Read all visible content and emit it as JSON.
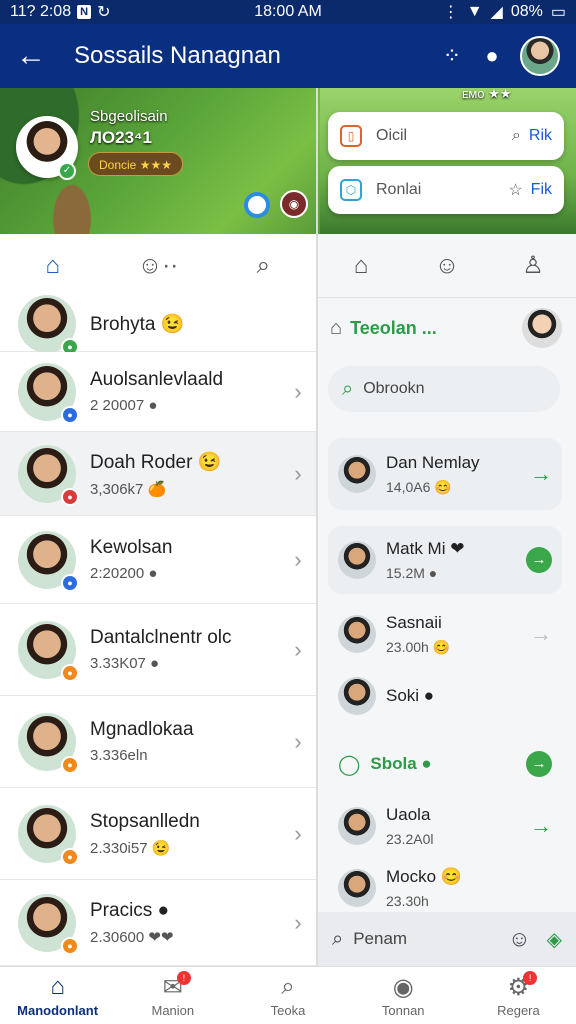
{
  "status": {
    "left": "11? 2:08",
    "center": "18:00 AM",
    "battery": "08%"
  },
  "appbar": {
    "title": "Sossails Nanagnan"
  },
  "banner": {
    "name_line1": "Sbgeolisain",
    "name_line2": "ЛО23⁴1",
    "pill": "Doncie ★★★",
    "top_right": "ᴇᴍᴏ ★★",
    "popup1": {
      "label": "Oicil",
      "action": "Rik"
    },
    "popup2": {
      "label": "Ronlai",
      "action": "Fik"
    }
  },
  "left_tabs": [
    "home",
    "emoji",
    "search"
  ],
  "right_tabs": [
    "home",
    "face",
    "person"
  ],
  "left_list": [
    {
      "name": "Brohyta 😉",
      "sub": "",
      "color": "#3aa84a"
    },
    {
      "name": "Auolsanlevlaald",
      "sub": "2 20007 ●",
      "color": "#2d6be0"
    },
    {
      "name": "Doah Roder 😉",
      "sub": "3,306k7 🍊",
      "color": "#d93b3b"
    },
    {
      "name": "Kewolsan",
      "sub": "2:20200 ●",
      "color": "#2d6be0"
    },
    {
      "name": "Dantalclnentr olc",
      "sub": "3.33K07 ●",
      "color": "#f08a1c"
    },
    {
      "name": "Mgnadlokaa",
      "sub": "3.336eln",
      "color": "#f08a1c"
    },
    {
      "name": "Stopsanlledn",
      "sub": "2.330i57 😉",
      "color": "#f08a1c"
    },
    {
      "name": "Pracics ●",
      "sub": "2.30600 ❤❤",
      "color": "#f08a1c"
    }
  ],
  "right_header": {
    "title": "Teeolan ...",
    "search": "Obrookn"
  },
  "right_list": [
    {
      "name": "Dan Nemlay",
      "sub": "14,0A6 😊",
      "style": "card"
    },
    {
      "name": "Matk Mi ❤",
      "sub": "15.2M ●",
      "style": "card-white"
    },
    {
      "name": "Sasnaii",
      "sub": "23.00h 😊",
      "style": "plain"
    },
    {
      "name": "Soki ●",
      "sub": "",
      "style": "plain"
    },
    {
      "name": "Sbola ●",
      "sub": "",
      "style": "section"
    },
    {
      "name": "Uaola",
      "sub": "23.2A0l",
      "style": "plain"
    },
    {
      "name": "Mocko 😊",
      "sub": "23.30h",
      "style": "plain"
    }
  ],
  "right_search": "Penam",
  "bottom_nav": [
    {
      "label": "Manodonlant",
      "icon": "home-icon",
      "active": true
    },
    {
      "label": "Manion",
      "icon": "chat-icon",
      "active": false
    },
    {
      "label": "Teoka",
      "icon": "search-icon",
      "active": false
    },
    {
      "label": "Tonnan",
      "icon": "avatar-icon",
      "active": false
    },
    {
      "label": "Regera",
      "icon": "settings-icon",
      "active": false
    }
  ],
  "colors": {
    "appbar": "#0b2f80",
    "accent": "#1e5bc6",
    "green": "#3aa84a"
  }
}
